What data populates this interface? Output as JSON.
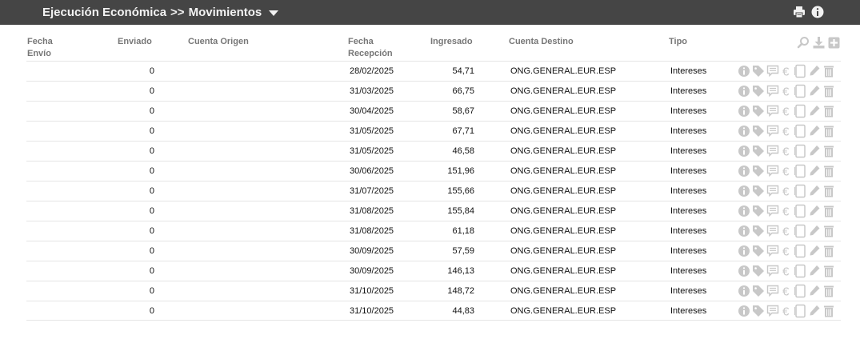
{
  "header": {
    "section": "Ejecución Económica",
    "separator": ">>",
    "page": "Movimientos",
    "print_icon": "printer-icon",
    "info_icon": "info-icon"
  },
  "table": {
    "columns": {
      "fecha_envio": "Fecha Envío",
      "enviado": "Enviado",
      "cuenta_origen": "Cuenta Origen",
      "fecha_recepcion": "Fecha Recepción",
      "ingresado": "Ingresado",
      "cuenta_destino": "Cuenta Destino",
      "tipo": "Tipo"
    },
    "header_tools": [
      "search-icon",
      "download-icon",
      "add-icon"
    ],
    "row_actions": [
      "info-icon",
      "tag-icon",
      "comment-icon",
      "euro-icon",
      "document-icon",
      "edit-icon",
      "trash-icon"
    ],
    "rows": [
      {
        "fecha_envio": "",
        "enviado": "0",
        "cuenta_origen": "",
        "fecha_recepcion": "28/02/2025",
        "ingresado": "54,71",
        "cuenta_destino": "ONG.GENERAL.EUR.ESP",
        "tipo": "Intereses"
      },
      {
        "fecha_envio": "",
        "enviado": "0",
        "cuenta_origen": "",
        "fecha_recepcion": "31/03/2025",
        "ingresado": "66,75",
        "cuenta_destino": "ONG.GENERAL.EUR.ESP",
        "tipo": "Intereses"
      },
      {
        "fecha_envio": "",
        "enviado": "0",
        "cuenta_origen": "",
        "fecha_recepcion": "30/04/2025",
        "ingresado": "58,67",
        "cuenta_destino": "ONG.GENERAL.EUR.ESP",
        "tipo": "Intereses"
      },
      {
        "fecha_envio": "",
        "enviado": "0",
        "cuenta_origen": "",
        "fecha_recepcion": "31/05/2025",
        "ingresado": "67,71",
        "cuenta_destino": "ONG.GENERAL.EUR.ESP",
        "tipo": "Intereses"
      },
      {
        "fecha_envio": "",
        "enviado": "0",
        "cuenta_origen": "",
        "fecha_recepcion": "31/05/2025",
        "ingresado": "46,58",
        "cuenta_destino": "ONG.GENERAL.EUR.ESP",
        "tipo": "Intereses"
      },
      {
        "fecha_envio": "",
        "enviado": "0",
        "cuenta_origen": "",
        "fecha_recepcion": "30/06/2025",
        "ingresado": "151,96",
        "cuenta_destino": "ONG.GENERAL.EUR.ESP",
        "tipo": "Intereses"
      },
      {
        "fecha_envio": "",
        "enviado": "0",
        "cuenta_origen": "",
        "fecha_recepcion": "31/07/2025",
        "ingresado": "155,66",
        "cuenta_destino": "ONG.GENERAL.EUR.ESP",
        "tipo": "Intereses"
      },
      {
        "fecha_envio": "",
        "enviado": "0",
        "cuenta_origen": "",
        "fecha_recepcion": "31/08/2025",
        "ingresado": "155,84",
        "cuenta_destino": "ONG.GENERAL.EUR.ESP",
        "tipo": "Intereses"
      },
      {
        "fecha_envio": "",
        "enviado": "0",
        "cuenta_origen": "",
        "fecha_recepcion": "31/08/2025",
        "ingresado": "61,18",
        "cuenta_destino": "ONG.GENERAL.EUR.ESP",
        "tipo": "Intereses"
      },
      {
        "fecha_envio": "",
        "enviado": "0",
        "cuenta_origen": "",
        "fecha_recepcion": "30/09/2025",
        "ingresado": "57,59",
        "cuenta_destino": "ONG.GENERAL.EUR.ESP",
        "tipo": "Intereses"
      },
      {
        "fecha_envio": "",
        "enviado": "0",
        "cuenta_origen": "",
        "fecha_recepcion": "30/09/2025",
        "ingresado": "146,13",
        "cuenta_destino": "ONG.GENERAL.EUR.ESP",
        "tipo": "Intereses"
      },
      {
        "fecha_envio": "",
        "enviado": "0",
        "cuenta_origen": "",
        "fecha_recepcion": "31/10/2025",
        "ingresado": "148,72",
        "cuenta_destino": "ONG.GENERAL.EUR.ESP",
        "tipo": "Intereses"
      },
      {
        "fecha_envio": "",
        "enviado": "0",
        "cuenta_origen": "",
        "fecha_recepcion": "31/10/2025",
        "ingresado": "44,83",
        "cuenta_destino": "ONG.GENERAL.EUR.ESP",
        "tipo": "Intereses"
      }
    ]
  },
  "colors": {
    "topbar": "#454545",
    "icon_gray": "#c8c8c8",
    "row_border": "#e5e5e5"
  }
}
